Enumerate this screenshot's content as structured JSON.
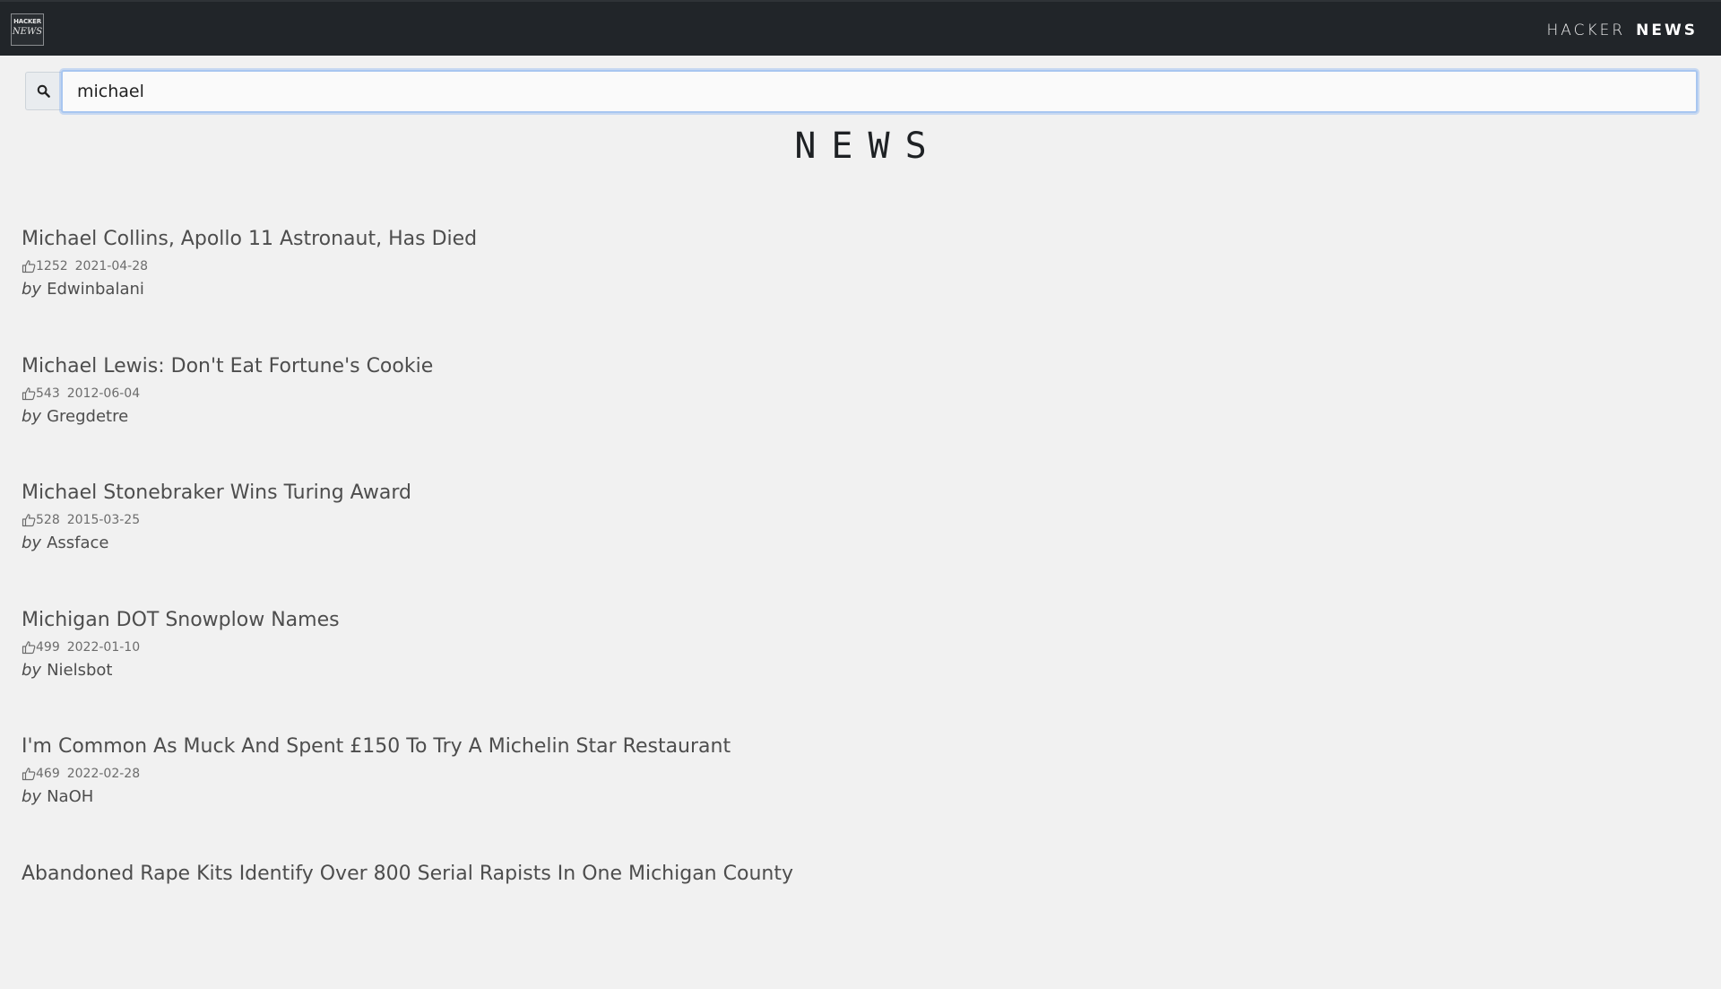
{
  "header": {
    "logo_top": "HACKER",
    "logo_bottom": "NEWS",
    "brand_left": "HACKER",
    "brand_right": "NEWS"
  },
  "search": {
    "value": "michael",
    "icon": "search-icon"
  },
  "page": {
    "title": "NEWS"
  },
  "labels": {
    "by": "by"
  },
  "news": [
    {
      "title": "Michael Collins, Apollo 11 Astronaut, Has Died",
      "points": "1252",
      "date": "2021-04-28",
      "author": "Edwinbalani"
    },
    {
      "title": "Michael Lewis: Don't Eat Fortune's Cookie",
      "points": "543",
      "date": "2012-06-04",
      "author": "Gregdetre"
    },
    {
      "title": "Michael Stonebraker Wins Turing Award",
      "points": "528",
      "date": "2015-03-25",
      "author": "Assface"
    },
    {
      "title": "Michigan DOT Snowplow Names",
      "points": "499",
      "date": "2022-01-10",
      "author": "Nielsbot"
    },
    {
      "title": "I'm Common As Muck And Spent £150 To Try A Michelin Star Restaurant",
      "points": "469",
      "date": "2022-02-28",
      "author": "NaOH"
    },
    {
      "title": "Abandoned Rape Kits Identify Over 800 Serial Rapists In One Michigan County",
      "points": "",
      "date": "",
      "author": ""
    }
  ],
  "colors": {
    "topbar": "#212529",
    "background": "#f1f1f1",
    "focus": "#a8c6f0"
  }
}
